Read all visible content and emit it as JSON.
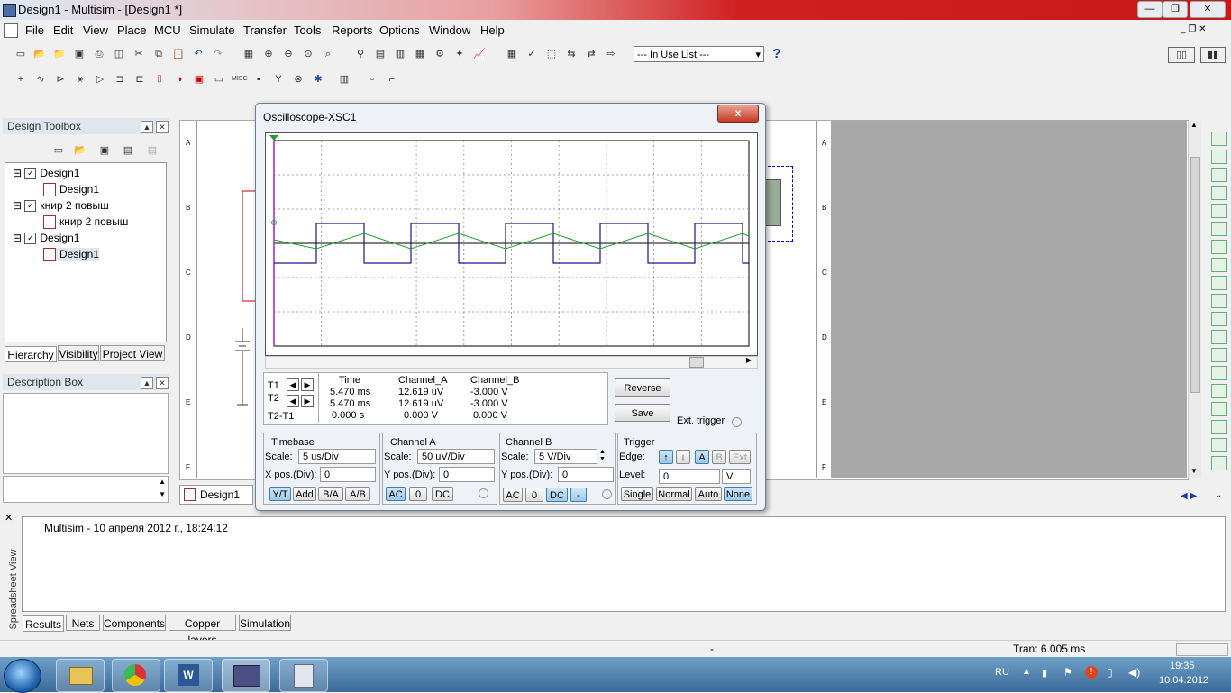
{
  "window": {
    "title": "Design1 - Multisim - [Design1 *]"
  },
  "menu": [
    "File",
    "Edit",
    "View",
    "Place",
    "MCU",
    "Simulate",
    "Transfer",
    "Tools",
    "Reports",
    "Options",
    "Window",
    "Help"
  ],
  "toolbar": {
    "in_use_list": "--- In Use List ---"
  },
  "design_toolbox": {
    "title": "Design Toolbox",
    "tree": [
      {
        "label": "Design1",
        "level": 0
      },
      {
        "label": "Design1",
        "level": 1
      },
      {
        "label": "книр 2 повыш",
        "level": 0
      },
      {
        "label": "книр 2 повыш",
        "level": 1
      },
      {
        "label": "Design1",
        "level": 0
      },
      {
        "label": "Design1",
        "level": 1
      }
    ],
    "tabs": [
      "Hierarchy",
      "Visibility",
      "Project View"
    ]
  },
  "description_box": {
    "title": "Description Box"
  },
  "schematic": {
    "row_letters": [
      "A",
      "B",
      "C",
      "D",
      "E",
      "F"
    ],
    "tab": "Design1"
  },
  "oscilloscope": {
    "title": "Oscilloscope-XSC1",
    "close": "x",
    "readout": {
      "headers": [
        "Time",
        "Channel_A",
        "Channel_B"
      ],
      "rows": [
        {
          "label": "T1",
          "time": "5.470 ms",
          "a": "12.619 uV",
          "b": "-3.000 V"
        },
        {
          "label": "T2",
          "time": "5.470 ms",
          "a": "12.619 uV",
          "b": "-3.000 V"
        },
        {
          "label": "T2-T1",
          "time": "0.000 s",
          "a": "0.000 V",
          "b": "0.000 V"
        }
      ]
    },
    "reverse": "Reverse",
    "save": "Save",
    "ext_trigger": "Ext. trigger",
    "timebase": {
      "title": "Timebase",
      "scale_label": "Scale:",
      "scale": "5 us/Div",
      "xpos_label": "X pos.(Div):",
      "xpos": "0",
      "buttons": [
        "Y/T",
        "Add",
        "B/A",
        "A/B"
      ]
    },
    "channel_a": {
      "title": "Channel A",
      "scale_label": "Scale:",
      "scale": "50 uV/Div",
      "ypos_label": "Y pos.(Div):",
      "ypos": "0",
      "buttons": [
        "AC",
        "0",
        "DC"
      ]
    },
    "channel_b": {
      "title": "Channel B",
      "scale_label": "Scale:",
      "scale": "5  V/Div",
      "ypos_label": "Y pos.(Div):",
      "ypos": "0",
      "buttons": [
        "AC",
        "0",
        "DC",
        "-"
      ]
    },
    "trigger": {
      "title": "Trigger",
      "edge_label": "Edge:",
      "level_label": "Level:",
      "level": "0",
      "unit": "V",
      "sources": [
        "A",
        "B",
        "Ext"
      ],
      "modes": [
        "Single",
        "Normal",
        "Auto",
        "None"
      ]
    }
  },
  "spreadsheet": {
    "side_label": "Spreadsheet View",
    "message": "Multisim  -  10 апреля 2012 г., 18:24:12",
    "tabs": [
      "Results",
      "Nets",
      "Components",
      "Copper layers",
      "Simulation"
    ]
  },
  "status": {
    "dash": "-",
    "tran": "Tran: 6.005 ms"
  },
  "taskbar": {
    "lang": "RU",
    "time": "19:35",
    "date": "10.04.2012"
  }
}
